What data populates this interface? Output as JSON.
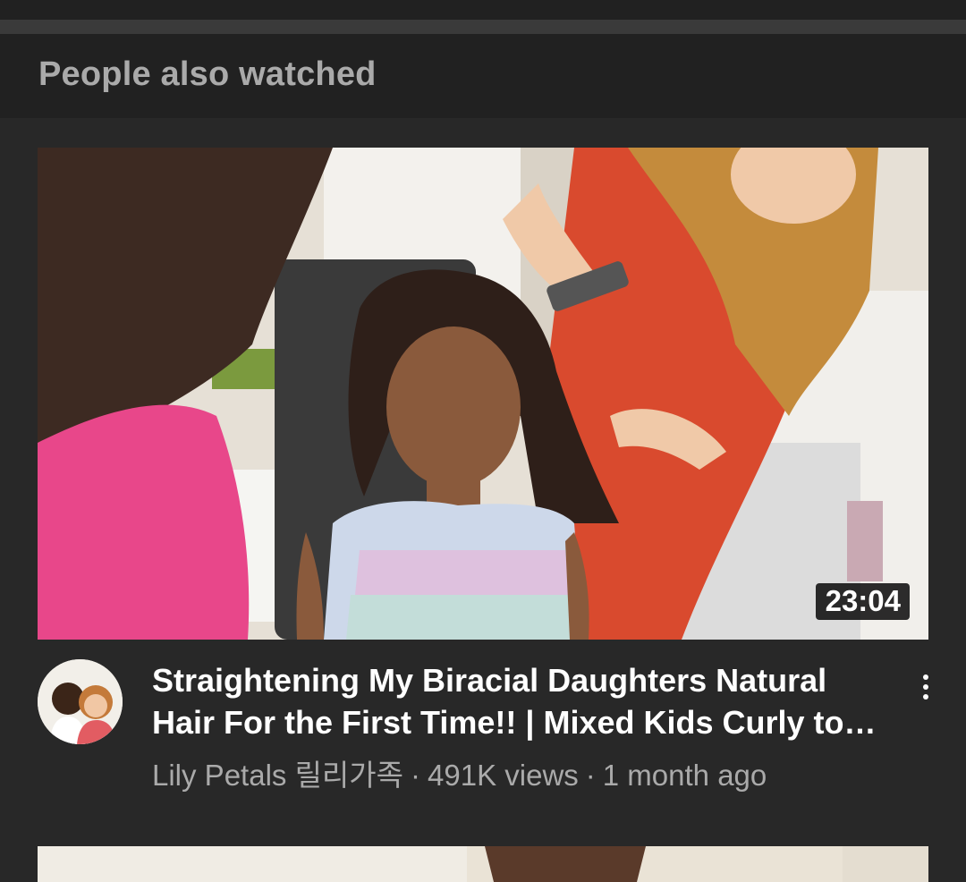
{
  "section": {
    "title": "People also watched"
  },
  "videos": [
    {
      "duration": "23:04",
      "title": "Straightening My Biracial Daughters Natural Hair For the First Time!! | Mixed Kids Curly to Straight",
      "channel": "Lily Petals 릴리가족",
      "views": "491K views",
      "age": "1 month ago",
      "menu_icon": "more-vertical-icon"
    }
  ],
  "colors": {
    "background": "#282828",
    "header_background": "#212121",
    "title_text": "#ffffff",
    "secondary_text": "#aaaaaa"
  }
}
